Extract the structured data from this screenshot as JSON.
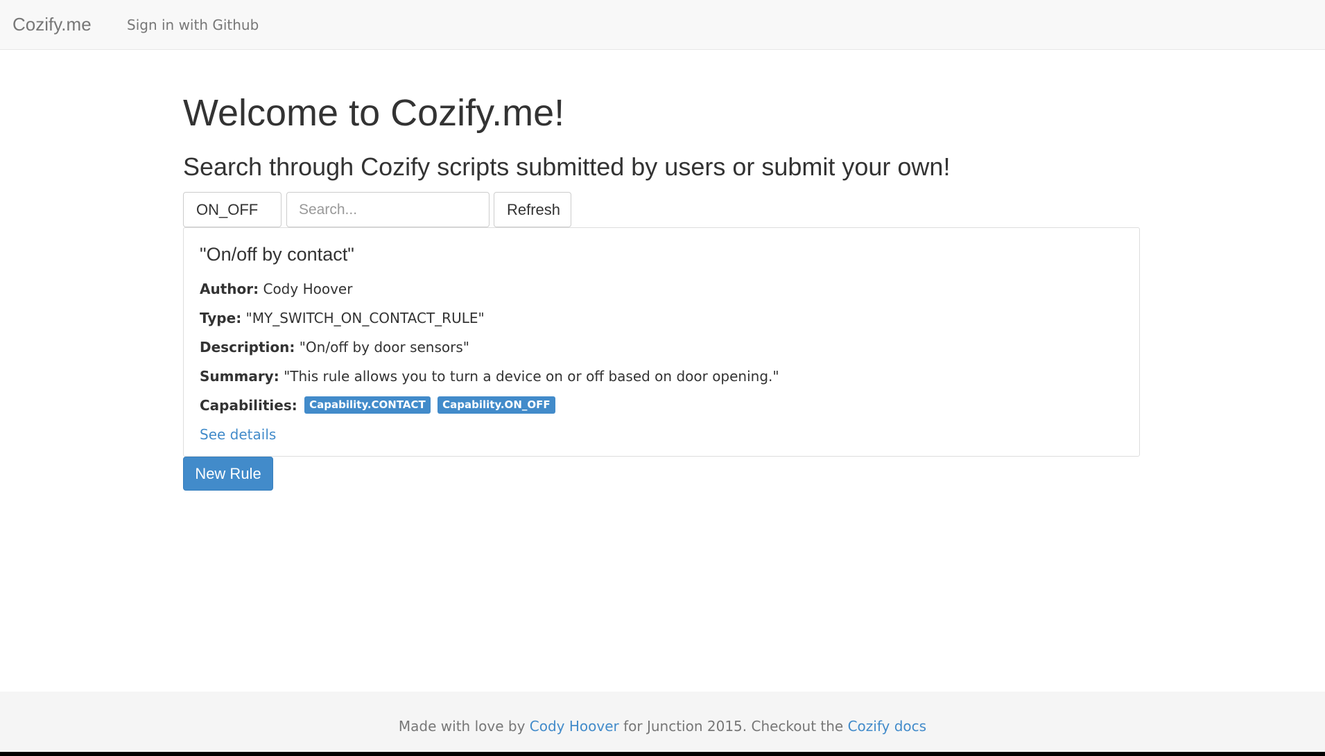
{
  "navbar": {
    "brand": "Cozify.me",
    "sign_in": "Sign in with Github"
  },
  "main": {
    "title": "Welcome to Cozify.me!",
    "subtitle": "Search through Cozify scripts submitted by users or submit your own!"
  },
  "controls": {
    "type_filter_selected": "ON_OFF",
    "search_placeholder": "Search...",
    "search_value": "",
    "refresh_label": "Refresh"
  },
  "rule": {
    "name": "\"On/off by contact\"",
    "author_label": "Author:",
    "author": "Cody Hoover",
    "type_label": "Type:",
    "type": "\"MY_SWITCH_ON_CONTACT_RULE\"",
    "description_label": "Description:",
    "description": "\"On/off by door sensors\"",
    "summary_label": "Summary:",
    "summary": "\"This rule allows you to turn a device on or off based on door opening.\"",
    "capabilities_label": "Capabilities:",
    "capabilities": [
      "Capability.CONTACT",
      "Capability.ON_OFF"
    ],
    "details_link": "See details"
  },
  "actions": {
    "new_rule_label": "New Rule"
  },
  "footer": {
    "text_1": "Made with love by ",
    "author_link": "Cody Hoover",
    "text_2": " for Junction 2015. Checkout the ",
    "docs_link": "Cozify docs"
  },
  "colors": {
    "primary": "#428bca",
    "navbar_bg": "#f8f8f8",
    "footer_bg": "#f5f5f5"
  },
  "icons": {
    "dropdown": "caret-down-icon"
  }
}
